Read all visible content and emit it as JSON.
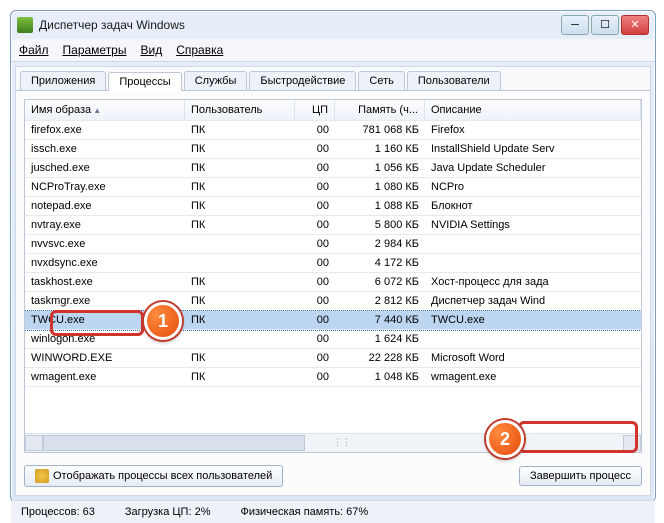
{
  "title": "Диспетчер задач Windows",
  "menu": [
    "Файл",
    "Параметры",
    "Вид",
    "Справка"
  ],
  "tabs": [
    "Приложения",
    "Процессы",
    "Службы",
    "Быстродействие",
    "Сеть",
    "Пользователи"
  ],
  "active_tab": 1,
  "columns": [
    "Имя образа",
    "Пользователь",
    "ЦП",
    "Память (ч...",
    "Описание"
  ],
  "rows": [
    {
      "name": "firefox.exe",
      "user": "ПК",
      "cpu": "00",
      "mem": "781 068 КБ",
      "desc": "Firefox"
    },
    {
      "name": "issch.exe",
      "user": "ПК",
      "cpu": "00",
      "mem": "1 160 КБ",
      "desc": "InstallShield Update Serv"
    },
    {
      "name": "jusched.exe",
      "user": "ПК",
      "cpu": "00",
      "mem": "1 056 КБ",
      "desc": "Java Update Scheduler"
    },
    {
      "name": "NCProTray.exe",
      "user": "ПК",
      "cpu": "00",
      "mem": "1 080 КБ",
      "desc": "NCPro"
    },
    {
      "name": "notepad.exe",
      "user": "ПК",
      "cpu": "00",
      "mem": "1 088 КБ",
      "desc": "Блокнот"
    },
    {
      "name": "nvtray.exe",
      "user": "ПК",
      "cpu": "00",
      "mem": "5 800 КБ",
      "desc": "NVIDIA Settings"
    },
    {
      "name": "nvvsvc.exe",
      "user": "",
      "cpu": "00",
      "mem": "2 984 КБ",
      "desc": ""
    },
    {
      "name": "nvxdsync.exe",
      "user": "",
      "cpu": "00",
      "mem": "4 172 КБ",
      "desc": ""
    },
    {
      "name": "taskhost.exe",
      "user": "ПК",
      "cpu": "00",
      "mem": "6 072 КБ",
      "desc": "Хост-процесс для зада"
    },
    {
      "name": "taskmgr.exe",
      "user": "ПК",
      "cpu": "00",
      "mem": "2 812 КБ",
      "desc": "Диспетчер задач Wind"
    },
    {
      "name": "TWCU.exe",
      "user": "ПК",
      "cpu": "00",
      "mem": "7 440 КБ",
      "desc": "TWCU.exe",
      "selected": true
    },
    {
      "name": "winlogon.exe",
      "user": "",
      "cpu": "00",
      "mem": "1 624 КБ",
      "desc": ""
    },
    {
      "name": "WINWORD.EXE",
      "user": "ПК",
      "cpu": "00",
      "mem": "22 228 КБ",
      "desc": "Microsoft Word"
    },
    {
      "name": "wmagent.exe",
      "user": "ПК",
      "cpu": "00",
      "mem": "1 048 КБ",
      "desc": "wmagent.exe"
    }
  ],
  "show_all_btn": "Отображать процессы всех пользователей",
  "end_btn": "Завершить процесс",
  "status": {
    "processes": "Процессов: 63",
    "cpu": "Загрузка ЦП: 2%",
    "mem": "Физическая память: 67%"
  },
  "markers": {
    "one": "1",
    "two": "2"
  }
}
